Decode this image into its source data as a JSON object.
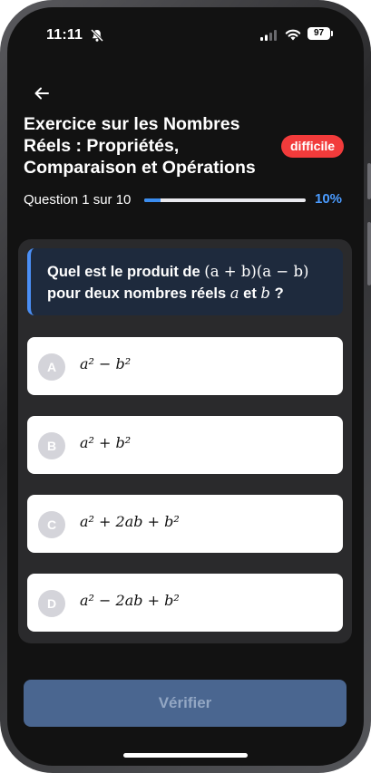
{
  "status_bar": {
    "time": "11:11",
    "battery": "97"
  },
  "header": {
    "title": "Exercice sur les Nombres Réels : Propriétés, Comparaison et Opérations",
    "difficulty": "difficile"
  },
  "progress": {
    "label": "Question 1 sur 10",
    "percent_label": "10%",
    "value": 0.1
  },
  "question": {
    "prefix": "Quel est le produit de ",
    "expression": "(a + b)(a − b)",
    "middle": " pour deux nombres réels ",
    "var_a": "a",
    "conjunction": " et ",
    "var_b": "b",
    "suffix": " ?"
  },
  "options": [
    {
      "letter": "A",
      "text": "a² − b²"
    },
    {
      "letter": "B",
      "text": "a² + b²"
    },
    {
      "letter": "C",
      "text": "a² + 2ab + b²"
    },
    {
      "letter": "D",
      "text": "a² − 2ab + b²"
    }
  ],
  "footer": {
    "verify_label": "Vérifier"
  },
  "colors": {
    "accent": "#4a9bff",
    "difficulty_badge": "#f23b3b",
    "verify_button": "#4a6690"
  }
}
